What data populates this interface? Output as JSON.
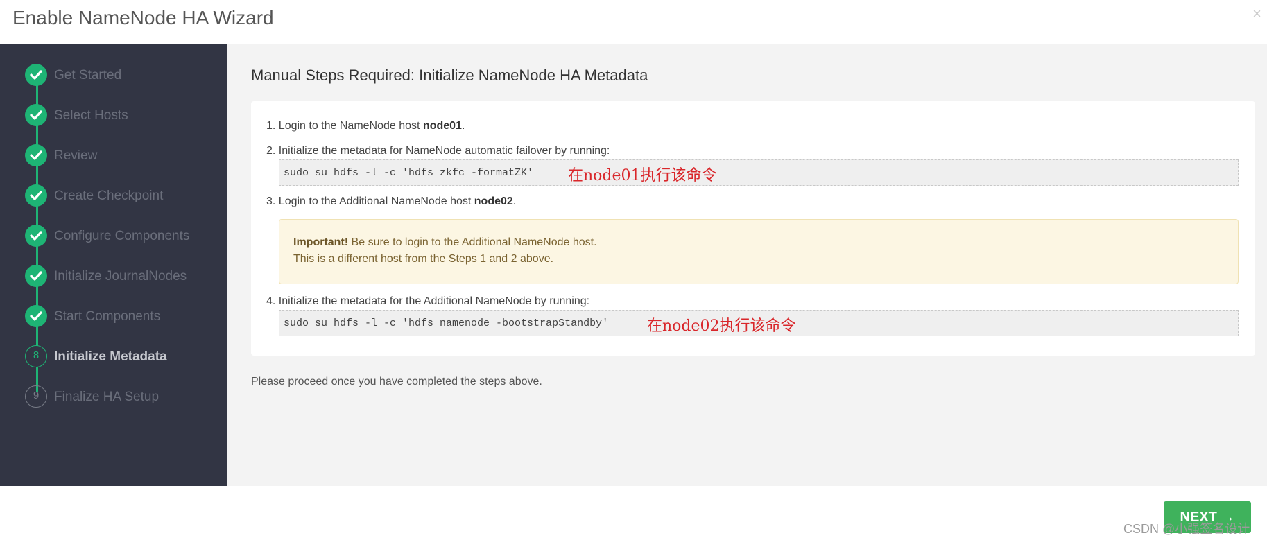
{
  "header": {
    "title": "Enable NameNode HA Wizard",
    "close_glyph": "×"
  },
  "sidebar": {
    "steps": [
      {
        "label": "Get Started",
        "state": "done"
      },
      {
        "label": "Select Hosts",
        "state": "done"
      },
      {
        "label": "Review",
        "state": "done"
      },
      {
        "label": "Create Checkpoint",
        "state": "done"
      },
      {
        "label": "Configure Components",
        "state": "done"
      },
      {
        "label": "Initialize JournalNodes",
        "state": "done"
      },
      {
        "label": "Start Components",
        "state": "done"
      },
      {
        "label": "Initialize Metadata",
        "state": "current",
        "number": "8"
      },
      {
        "label": "Finalize HA Setup",
        "state": "pending",
        "number": "9"
      }
    ]
  },
  "main": {
    "title": "Manual Steps Required: Initialize NameNode HA Metadata",
    "step1": {
      "prefix": "1. Login to the NameNode host ",
      "host": "node01",
      "suffix": "."
    },
    "step2": {
      "text": "2. Initialize the metadata for NameNode automatic failover by running:"
    },
    "cmd1": {
      "command": "sudo su hdfs -l -c 'hdfs zkfc -formatZK'",
      "note": "在node01执行该命令"
    },
    "step3": {
      "prefix": "3. Login to the Additional NameNode host ",
      "host": "node02",
      "suffix": "."
    },
    "alert": {
      "strong": "Important!",
      "line1": " Be sure to login to the Additional NameNode host.",
      "line2": "This is a different host from the Steps 1 and 2 above."
    },
    "step4": {
      "text": "4. Initialize the metadata for the Additional NameNode by running:"
    },
    "cmd2": {
      "command": "sudo su hdfs -l -c 'hdfs namenode -bootstrapStandby'",
      "note": "在node02执行该命令"
    },
    "proceed": "Please proceed once you have completed the steps above."
  },
  "footer": {
    "next_label": "NEXT →",
    "watermark": "CSDN @小强签名设计"
  },
  "colors": {
    "sidebar_bg": "#323544",
    "accent_green": "#1eb475",
    "next_button": "#3fb25c",
    "annotation_red": "#d9262a"
  }
}
